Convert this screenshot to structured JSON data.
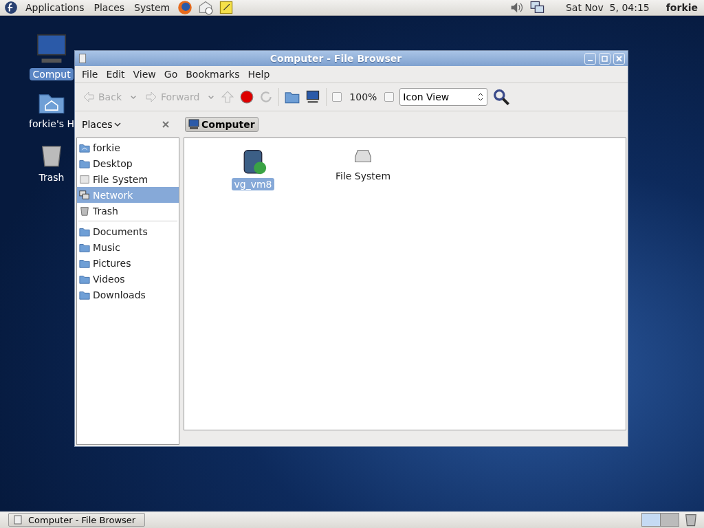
{
  "top_panel": {
    "menus": [
      "Applications",
      "Places",
      "System"
    ],
    "clock": "Sat Nov  5, 04:15",
    "user": "forkie"
  },
  "desktop_icons": [
    {
      "label": "Comput",
      "kind": "computer",
      "selected": true
    },
    {
      "label": "forkie's H",
      "kind": "home",
      "selected": false
    },
    {
      "label": "Trash",
      "kind": "trash",
      "selected": false
    }
  ],
  "window": {
    "title": "Computer - File Browser",
    "menu": [
      "File",
      "Edit",
      "View",
      "Go",
      "Bookmarks",
      "Help"
    ],
    "toolbar": {
      "back": {
        "label": "Back",
        "disabled": true
      },
      "forward": {
        "label": "Forward",
        "disabled": true
      },
      "zoom": "100%",
      "view": "Icon View"
    },
    "location": {
      "label": "Computer"
    },
    "sidebar": {
      "title": "Places",
      "groups": [
        [
          {
            "label": "forkie",
            "kind": "home",
            "selected": false
          },
          {
            "label": "Desktop",
            "kind": "folder",
            "selected": false
          },
          {
            "label": "File System",
            "kind": "drive",
            "selected": false
          },
          {
            "label": "Network",
            "kind": "network",
            "selected": true
          },
          {
            "label": "Trash",
            "kind": "trash",
            "selected": false
          }
        ],
        [
          {
            "label": "Documents",
            "kind": "folder",
            "selected": false
          },
          {
            "label": "Music",
            "kind": "folder",
            "selected": false
          },
          {
            "label": "Pictures",
            "kind": "folder",
            "selected": false
          },
          {
            "label": "Videos",
            "kind": "folder",
            "selected": false
          },
          {
            "label": "Downloads",
            "kind": "folder",
            "selected": false
          }
        ]
      ]
    },
    "items": [
      {
        "label": "vg_vm8",
        "kind": "volume",
        "selected": true
      },
      {
        "label": "File System",
        "kind": "drive",
        "selected": false
      }
    ]
  },
  "taskbar": {
    "tasks": [
      {
        "label": "Computer - File Browser",
        "selected": false
      }
    ]
  }
}
